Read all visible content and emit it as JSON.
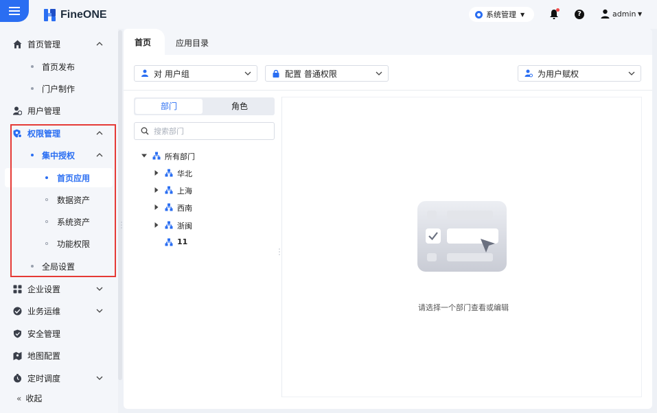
{
  "app": {
    "brand": "FineONE",
    "system_menu": "系统管理",
    "user": "admin"
  },
  "sidebar": {
    "items": [
      {
        "label": "首页管理",
        "icon": "home-icon"
      },
      {
        "label": "首页发布"
      },
      {
        "label": "门户制作"
      },
      {
        "label": "用户管理",
        "icon": "users-icon"
      },
      {
        "label": "权限管理",
        "icon": "permission-icon"
      },
      {
        "label": "集中授权"
      },
      {
        "label": "首页应用"
      },
      {
        "label": "数据资产"
      },
      {
        "label": "系统资产"
      },
      {
        "label": "功能权限"
      },
      {
        "label": "全局设置"
      },
      {
        "label": "企业设置",
        "icon": "grid-icon"
      },
      {
        "label": "业务运维",
        "icon": "operations-icon"
      },
      {
        "label": "安全管理",
        "icon": "shield-icon"
      },
      {
        "label": "地图配置",
        "icon": "map-icon"
      },
      {
        "label": "定时调度",
        "icon": "timer-icon"
      }
    ],
    "collapse": "收起"
  },
  "tabs": {
    "home": "首页",
    "apps": "应用目录"
  },
  "toolbar": {
    "target": "对 用户组",
    "config": "配置 普通权限",
    "mode": "为用户赋权"
  },
  "segment": {
    "dept": "部门",
    "role": "角色"
  },
  "search": {
    "placeholder": "搜索部门"
  },
  "tree": {
    "root": "所有部门",
    "children": [
      "华北",
      "上海",
      "西南",
      "浙闽",
      "11"
    ]
  },
  "empty": {
    "message": "请选择一个部门查看或编辑"
  },
  "colors": {
    "accent": "#2a6ef2",
    "highlight_border": "#e53935"
  }
}
